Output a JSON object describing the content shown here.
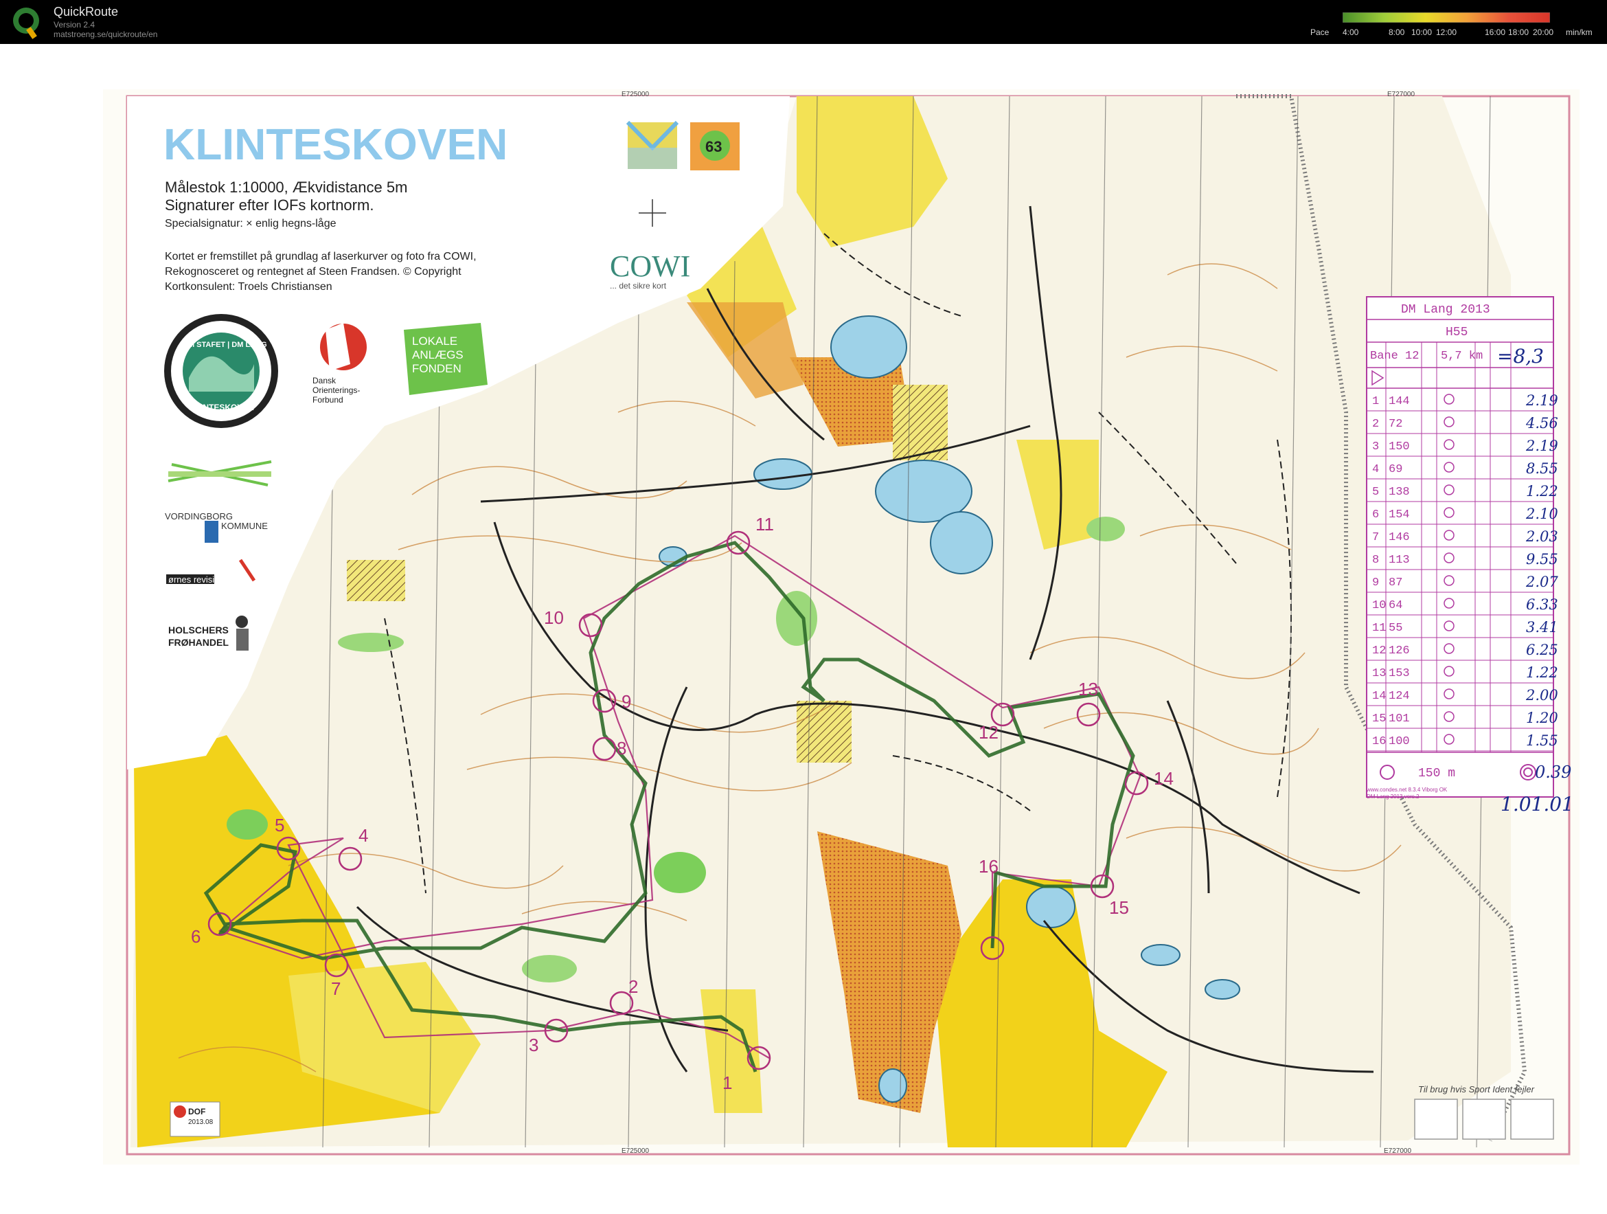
{
  "app": {
    "title": "QuickRoute",
    "version": "Version 2.4",
    "url": "matstroeng.se/quickroute/en",
    "logo_letter": "Q"
  },
  "pace_legend": {
    "label": "Pace",
    "ticks": [
      "4:00",
      "8:00",
      "10:00",
      "12:00",
      "16:00",
      "18:00",
      "20:00"
    ],
    "unit": "min/km",
    "gradient_colors": [
      "#4a8f2a",
      "#9fcd3a",
      "#e8d92a",
      "#f2a13a",
      "#e8523a",
      "#d8362a"
    ]
  },
  "map": {
    "title": "KLINTESKOVEN",
    "scale_line": "Målestok 1:10000,  Ækvidistance  5m",
    "norm_line": "Signaturer efter IOFs kortnorm.",
    "special_line": "Specialsignatur:  ×  enlig hegns-låge",
    "credits": [
      "Kortet er fremstillet på grundlag af laserkurver og foto fra COWI,",
      "Rekognosceret og rentegnet af Steen Frandsen.   ©  Copyright",
      "Kortkonsulent: Troels Christiansen"
    ],
    "cowi": "COWI",
    "cowi_tagline": "... det sikre kort",
    "badge_63": "63",
    "do_logo_lines": [
      "Dansk",
      "Orienterings-",
      "Forbund"
    ],
    "lokale_lines": [
      "LOKALE",
      "ANLÆGS",
      "FONDEN"
    ],
    "dm_badge_top": "DM STAFET | DM LANG",
    "dm_badge_bottom": "KLINTESKOVEN",
    "vordingborg": [
      "VORDINGBORG",
      "KOMMUNE"
    ],
    "revision": "ørnes revision",
    "holschers": [
      "HOLSCHERS",
      "FRØHANDEL"
    ],
    "grid_labels": [
      "E725000",
      "E727000",
      "E725000",
      "E727000"
    ],
    "dof_stamp": [
      "DOF",
      "2013.08"
    ],
    "fallback_note": "Til brug hvis Sport Ident fejler",
    "control_numbers": [
      "1",
      "2",
      "3",
      "4",
      "5",
      "6",
      "7",
      "8",
      "9",
      "10",
      "11",
      "12",
      "13",
      "14",
      "15",
      "16"
    ]
  },
  "control_card": {
    "event": "DM Lang 2013",
    "class": "H55",
    "course": "Bane 12",
    "length": "5,7 km",
    "handwritten_length": "=8,3",
    "rows": [
      {
        "n": "1",
        "code": "144",
        "split": "2.19"
      },
      {
        "n": "2",
        "code": "72",
        "split": "4.56"
      },
      {
        "n": "3",
        "code": "150",
        "split": "2.19"
      },
      {
        "n": "4",
        "code": "69",
        "split": "8.55"
      },
      {
        "n": "5",
        "code": "138",
        "split": "1.22"
      },
      {
        "n": "6",
        "code": "154",
        "split": "2.10"
      },
      {
        "n": "7",
        "code": "146",
        "split": "2.03"
      },
      {
        "n": "8",
        "code": "113",
        "split": "9.55"
      },
      {
        "n": "9",
        "code": "87",
        "split": "2.07"
      },
      {
        "n": "10",
        "code": "64",
        "split": "6.33"
      },
      {
        "n": "11",
        "code": "55",
        "split": "3.41"
      },
      {
        "n": "12",
        "code": "126",
        "split": "6.25"
      },
      {
        "n": "13",
        "code": "153",
        "split": "1.22"
      },
      {
        "n": "14",
        "code": "124",
        "split": "2.00"
      },
      {
        "n": "15",
        "code": "101",
        "split": "1.20"
      },
      {
        "n": "16",
        "code": "100",
        "split": "1.55"
      }
    ],
    "finish_distance": "150 m",
    "finish_split": "0.39",
    "total_time": "1.01.01",
    "footer": [
      "www.condes.net 8.3.4 Viborg OK",
      "DM Lang 2013 vers.2"
    ]
  }
}
